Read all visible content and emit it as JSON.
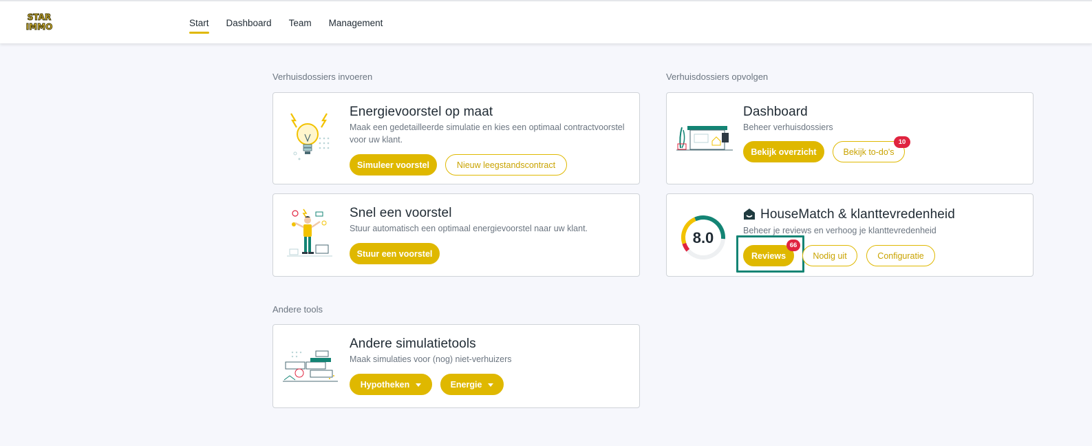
{
  "logo": {
    "line1": "STAR",
    "line2": "IMMO"
  },
  "nav": {
    "items": [
      {
        "label": "Start",
        "active": true
      },
      {
        "label": "Dashboard",
        "active": false
      },
      {
        "label": "Team",
        "active": false
      },
      {
        "label": "Management",
        "active": false
      }
    ]
  },
  "sections": {
    "invoeren": "Verhuisdossiers invoeren",
    "opvolgen": "Verhuisdossiers opvolgen",
    "andere": "Andere tools"
  },
  "cards": {
    "energievoorstel": {
      "title": "Energievoorstel op maat",
      "desc": "Maak een gedetailleerde simulatie en kies een optimaal contractvoorstel voor uw klant.",
      "btn_primary": "Simuleer voorstel",
      "btn_secondary": "Nieuw leegstandscontract"
    },
    "snel": {
      "title": "Snel een voorstel",
      "desc": "Stuur automatisch een optimaal energievoorstel naar uw klant.",
      "btn_primary": "Stuur een voorstel"
    },
    "dashboard": {
      "title": "Dashboard",
      "desc": "Beheer verhuisdossiers",
      "btn_primary": "Bekijk overzicht",
      "btn_secondary": "Bekijk to-do's",
      "todo_count": "10"
    },
    "housematch": {
      "title": "HouseMatch & klanttevredenheid",
      "desc": "Beheer je reviews en verhoog je klanttevredenheid",
      "score": "8.0",
      "score_fraction": 0.8,
      "btn_reviews": "Reviews",
      "reviews_count": "66",
      "btn_nodig": "Nodig uit",
      "btn_config": "Configuratie"
    },
    "andere": {
      "title": "Andere simulatietools",
      "desc": "Maak simulaties voor (nog) niet-verhuizers",
      "btn_hypotheken": "Hypotheken",
      "btn_energie": "Energie"
    }
  },
  "colors": {
    "accent": "#dfb800",
    "badge": "#e0243f",
    "highlight": "#138474",
    "gauge_green": "#138474",
    "gauge_yellow": "#f2c200",
    "gauge_red": "#e0243f"
  }
}
